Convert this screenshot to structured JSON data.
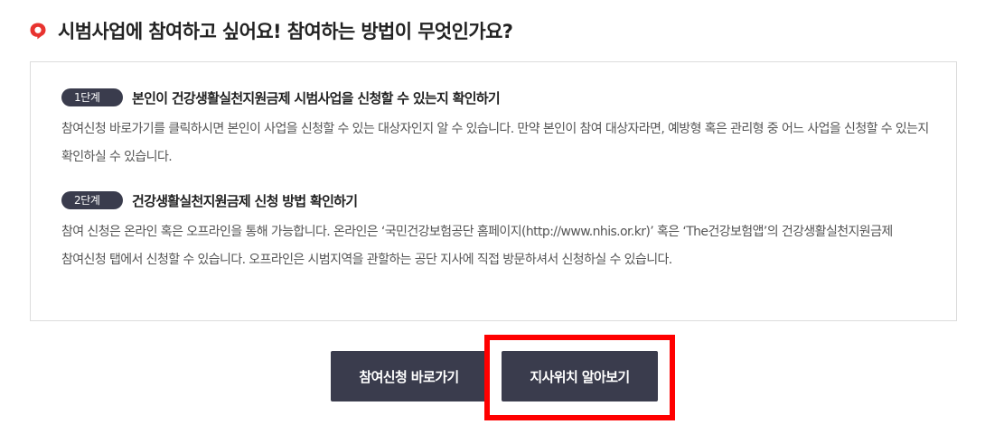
{
  "header": {
    "icon": "speech-bubble-icon",
    "title": "시범사업에 참여하고 싶어요! 참여하는 방법이 무엇인가요?"
  },
  "steps": [
    {
      "badge": "1단계",
      "title": "본인이 건강생활실천지원금제 시범사업을 신청할 수 있는지 확인하기",
      "body": "참여신청 바로가기를 클릭하시면 본인이 사업을 신청할 수 있는 대상자인지 알 수 있습니다. 만약 본인이 참여 대상자라면, 예방형 혹은 관리형 중 어느 사업을 신청할 수 있는지 확인하실 수 있습니다."
    },
    {
      "badge": "2단계",
      "title": "건강생활실천지원금제 신청 방법 확인하기",
      "body": "참여 신청은 온라인 혹은 오프라인을 통해 가능합니다. 온라인은 ‘국민건강보험공단 홈페이지(http://www.nhis.or.kr)’ 혹은 ‘The건강보험앱’의 건강생활실천지원금제 참여신청 탭에서 신청할 수 있습니다. 오프라인은 시범지역을 관할하는 공단 지사에 직접 방문하셔서 신청하실 수 있습니다."
    }
  ],
  "buttons": {
    "apply": "참여신청 바로가기",
    "branch": "지사위치 알아보기"
  },
  "colors": {
    "accent": "#e8332f",
    "button_bg": "#3a3c4d",
    "highlight": "#ff0000"
  }
}
